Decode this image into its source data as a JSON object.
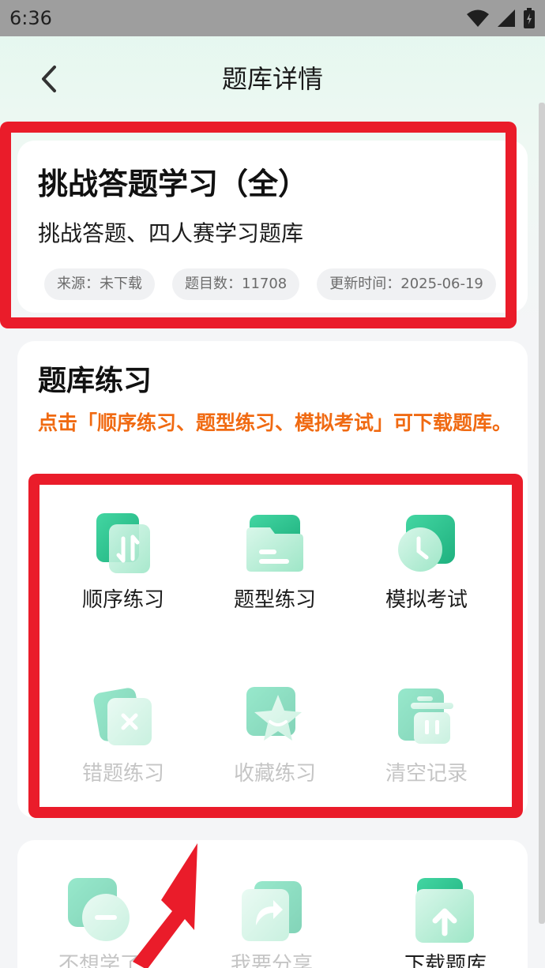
{
  "status_bar": {
    "time": "6:36"
  },
  "nav": {
    "title": "题库详情"
  },
  "bank": {
    "title": "挑战答题学习（全）",
    "subtitle": "挑战答题、四人赛学习题库",
    "tags": [
      "来源：未下载",
      "题目数：11708",
      "更新时间：2025-06-19"
    ]
  },
  "practice": {
    "title": "题库练习",
    "hint": "点击「顺序练习、题型练习、模拟考试」可下载题库。",
    "items": [
      {
        "label": "顺序练习",
        "icon": "sequence-icon",
        "enabled": true
      },
      {
        "label": "题型练习",
        "icon": "folder-icon",
        "enabled": true
      },
      {
        "label": "模拟考试",
        "icon": "clock-icon",
        "enabled": true
      },
      {
        "label": "错题练习",
        "icon": "wrong-icon",
        "enabled": false
      },
      {
        "label": "收藏练习",
        "icon": "star-icon",
        "enabled": false
      },
      {
        "label": "清空记录",
        "icon": "trash-icon",
        "enabled": false
      }
    ]
  },
  "actions": {
    "items": [
      {
        "label": "不想学了",
        "icon": "minus-icon",
        "enabled": false
      },
      {
        "label": "我要分享",
        "icon": "share-icon",
        "enabled": false
      },
      {
        "label": "下载题库",
        "icon": "download-icon",
        "enabled": true
      }
    ]
  },
  "colors": {
    "accent_green": "#2cc08e",
    "hint_orange": "#f06a12",
    "highlight_red": "#ea1c2a"
  }
}
